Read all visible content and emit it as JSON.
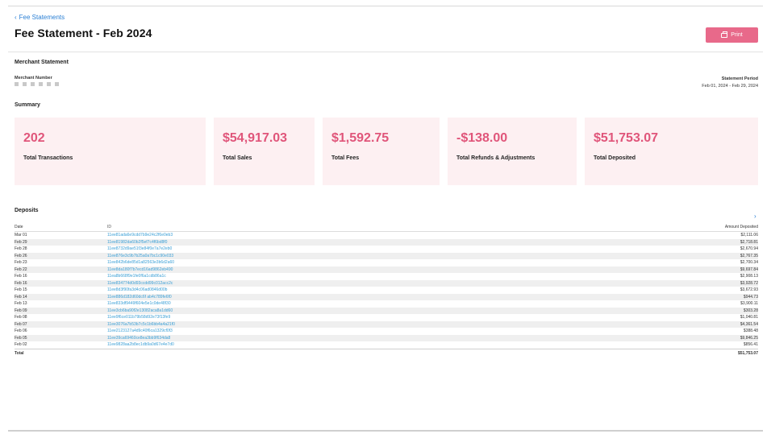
{
  "breadcrumb": {
    "label": "Fee Statements"
  },
  "page_title": "Fee Statement - Feb 2024",
  "print_button": {
    "label": "Print"
  },
  "merchant": {
    "section_title": "Merchant Statement",
    "number_label": "Merchant Number",
    "period_label": "Statement Period",
    "period_value": "Feb 01, 2024 - Feb 29, 2024"
  },
  "summary": {
    "section_title": "Summary",
    "cards": [
      {
        "value": "202",
        "label": "Total Transactions"
      },
      {
        "value": "$54,917.03",
        "label": "Total Sales"
      },
      {
        "value": "$1,592.75",
        "label": "Total Fees"
      },
      {
        "value": "-$138.00",
        "label": "Total Refunds & Adjustments"
      },
      {
        "value": "$51,753.07",
        "label": "Total Deposited"
      }
    ]
  },
  "deposits": {
    "section_title": "Deposits",
    "columns": {
      "date": "Date",
      "id": "ID",
      "amount": "Amount Deposited"
    },
    "rows": [
      {
        "date": "Mar 01",
        "id": "11ee81ada6e9cdd7b9e24c2f6e0eb3",
        "amount": "$2,111.06"
      },
      {
        "date": "Feb 29",
        "id": "11ee81982da60b2f5ef7c4f6bd8f0",
        "amount": "$2,718.81"
      },
      {
        "date": "Feb 28",
        "id": "11ee8732d9ae51f3e84f0e7a7e2eb0",
        "amount": "$2,670.94"
      },
      {
        "date": "Feb 26",
        "id": "11ee876e3c9b7b25a0a7bc1c90e033",
        "amount": "$2,767.35"
      },
      {
        "date": "Feb 23",
        "id": "11ee842b6de85d1a82563e3b6d2a60",
        "amount": "$2,700.34"
      },
      {
        "date": "Feb 22",
        "id": "11ee8da180f7b7ecd16ad9862eb490",
        "amount": "$9,697.84"
      },
      {
        "date": "Feb 16",
        "id": "11ea8b668f9e1fe0f6a1cdb86a1c",
        "amount": "$2,908.13"
      },
      {
        "date": "Feb 16",
        "id": "11ee834774d0d93ccdd99c012acc2c",
        "amount": "$3,928.72"
      },
      {
        "date": "Feb 15",
        "id": "11ee8d3f90fa3d4c06ad0846d00b",
        "amount": "$3,672.93"
      },
      {
        "date": "Feb 14",
        "id": "11ee886d182d60dc6f ab4c789fe6f0",
        "amount": "$944.73"
      },
      {
        "date": "Feb 13",
        "id": "11ee833df9449f604e5e1c0de48f30",
        "amount": "$3,900.11"
      },
      {
        "date": "Feb 09",
        "id": "11ee3cb6ba90f2e13082aca8a1dd60",
        "amount": "$303.28"
      },
      {
        "date": "Feb 08",
        "id": "11ee9f6ce011b79b58d92e73f13fe9",
        "amount": "$1,040.81"
      },
      {
        "date": "Feb 07",
        "id": "11ee3076a7b53b7c5c1b6bb4a4a21f0",
        "amount": "$4,361.54"
      },
      {
        "date": "Feb 06",
        "id": "11ee2123127a4d9c40f6ca1329cf0f3",
        "amount": "$388.48"
      },
      {
        "date": "Feb 05",
        "id": "11ee39ca69460ce8ea3bb9f634da8",
        "amount": "$9,846.25"
      },
      {
        "date": "Feb 02",
        "id": "11ee9828aa2b8ec1db9a0d67e4e7d0",
        "amount": "$856.41"
      }
    ],
    "total_label": "Total",
    "total_amount": "$51,753.07"
  }
}
